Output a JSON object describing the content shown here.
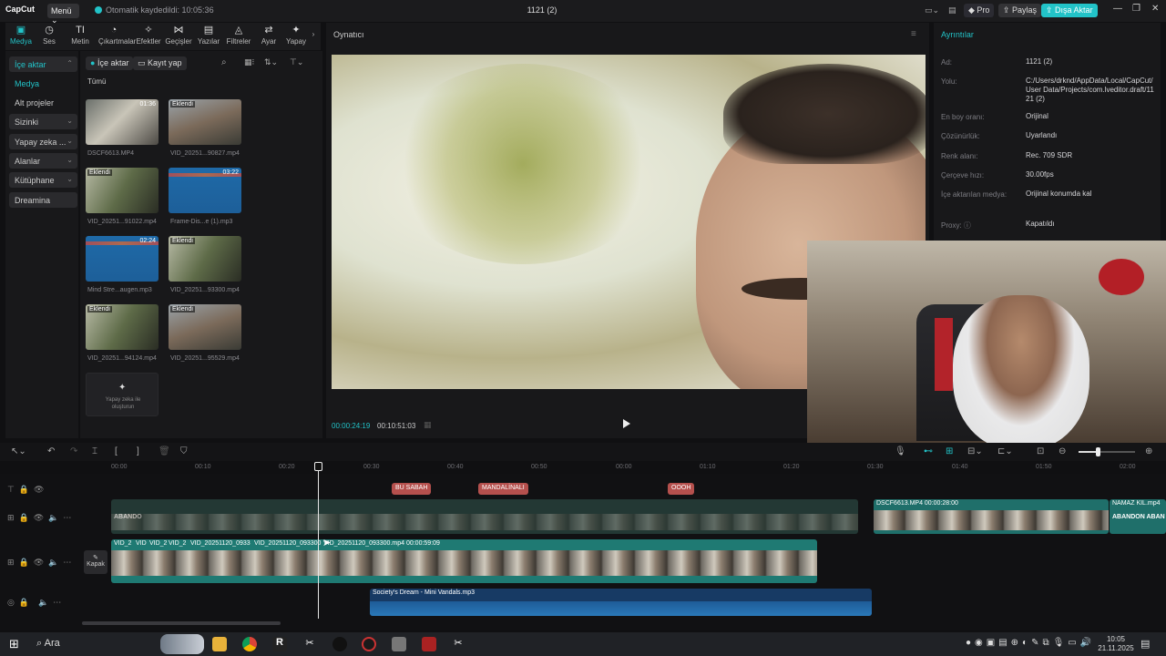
{
  "app": {
    "logo": "CapCut",
    "menu_label": "Menü",
    "autosave_text": "Otomatik kaydedildi: 10:05:36",
    "project_title": "1121 (2)",
    "pro_label": "Pro",
    "share_label": "Paylaş",
    "export_label": "Dışa Aktar",
    "accent_color": "#22c3c8"
  },
  "toolbar": {
    "items": [
      {
        "label": "Medya",
        "icon": "media-icon",
        "active": true
      },
      {
        "label": "Ses",
        "icon": "audio-icon"
      },
      {
        "label": "Metin",
        "icon": "text-icon"
      },
      {
        "label": "Çıkartmalar",
        "icon": "sticker-icon"
      },
      {
        "label": "Efektler",
        "icon": "effects-icon"
      },
      {
        "label": "Geçişler",
        "icon": "transitions-icon"
      },
      {
        "label": "Yazılar",
        "icon": "captions-icon"
      },
      {
        "label": "Filtreler",
        "icon": "filters-icon"
      },
      {
        "label": "Ayar",
        "icon": "adjust-icon"
      },
      {
        "label": "Yapay",
        "icon": "ai-icon"
      }
    ]
  },
  "leftnav": {
    "items": [
      {
        "label": "İçe aktar",
        "chev": "⌃"
      },
      {
        "label": "Medya"
      },
      {
        "label": "Alt projeler"
      },
      {
        "label": "Sizinki",
        "chev": "⌄"
      },
      {
        "label": "Yapay zeka ...",
        "chev": "⌄"
      },
      {
        "label": "Alanlar",
        "chev": "⌄"
      },
      {
        "label": "Kütüphane",
        "chev": "⌄"
      },
      {
        "label": "Dreamina"
      }
    ]
  },
  "media": {
    "import_label": "İçe aktar",
    "record_label": "Kayıt yap",
    "filter_label": "Tümü",
    "items": [
      {
        "name": "DSCF6613.MP4",
        "badge": "",
        "duration": "01:36",
        "kind": "vid"
      },
      {
        "name": "VID_20251...90827.mp4",
        "badge": "Eklendi",
        "duration": "",
        "kind": "vid2"
      },
      {
        "name": "VID_20251...91022.mp4",
        "badge": "Eklendi",
        "duration": "",
        "kind": "vid3"
      },
      {
        "name": "Frame-Dis...e (1).mp3",
        "badge": "",
        "duration": "03:22",
        "kind": "aud"
      },
      {
        "name": "Mind Stre...augen.mp3",
        "badge": "",
        "duration": "02:24",
        "kind": "aud"
      },
      {
        "name": "VID_20251...93300.mp4",
        "badge": "Eklendi",
        "duration": "",
        "kind": "vid3"
      },
      {
        "name": "VID_20251...94124.mp4",
        "badge": "Eklendi",
        "duration": "",
        "kind": "vid3"
      },
      {
        "name": "VID_20251...95529.mp4",
        "badge": "Eklendi",
        "duration": "",
        "kind": "vid2"
      }
    ],
    "ai_create_label": "Yapay zeka ile oluşturun"
  },
  "player": {
    "title": "Oynatıcı",
    "current_time": "00:00:24:19",
    "total_time": "00:10:51:03"
  },
  "details": {
    "title": "Ayrıntılar",
    "rows": [
      {
        "label": "Ad:",
        "value": "1121 (2)"
      },
      {
        "label": "Yolu:",
        "value": "C:/Users/drknd/AppData/Local/CapCut/User Data/Projects/com.lveditor.draft/1121 (2)"
      },
      {
        "label": "En boy oranı:",
        "value": "Orijinal"
      },
      {
        "label": "Çözünürlük:",
        "value": "Uyarlandı"
      },
      {
        "label": "Renk alanı:",
        "value": "Rec. 709 SDR"
      },
      {
        "label": "Çerçeve hızı:",
        "value": "30.00fps"
      },
      {
        "label": "İçe aktarılan medya:",
        "value": "Orijinal konumda kal"
      },
      {
        "label": "Proxy: ⓘ",
        "value": "Kapatıldı"
      }
    ]
  },
  "timeline": {
    "ruler": [
      "00:00",
      "00:10",
      "00:20",
      "00:30",
      "00:40",
      "00:50",
      "00:00",
      "01:10",
      "01:20",
      "01:30",
      "01:40",
      "01:50",
      "02:00"
    ],
    "text_clips": [
      "BU SABAH",
      "MANDALİNALI",
      "OOOH"
    ],
    "overlay_clips": [
      {
        "label": "ABANDO",
        "color": "#2a3f3a"
      },
      {
        "label": "DSCF6613.MP4   00:00:28:00",
        "color": "#1f6f6a"
      },
      {
        "label": "NAMAZ KIL.mp4",
        "color": "#1f6f6a"
      }
    ],
    "overlay_caption": "ABANDON ABAN",
    "main_clips": [
      "VID_2",
      "VID",
      "VID_2",
      "VID_2",
      "VID_20251120_0933",
      "VID_20251120_093300",
      "VID_20251120_093300.mp4   00:00:59:09"
    ],
    "cover_label": "Kapak",
    "audio_clip": "Society's Dream - Mini Vandals.mp3"
  },
  "taskbar": {
    "search_label": "Ara",
    "time": "10:05",
    "date": "21.11.2025"
  }
}
